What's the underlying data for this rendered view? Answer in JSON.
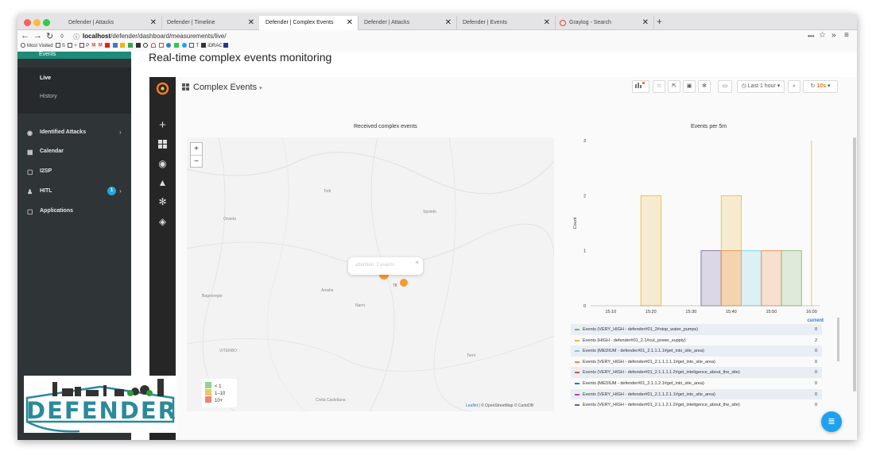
{
  "browser": {
    "tabs": [
      {
        "label": "Defender | Attacks",
        "active": false
      },
      {
        "label": "Defender | Timeline",
        "active": false
      },
      {
        "label": "Defender | Complex Events",
        "active": true
      },
      {
        "label": "Defender | Attacks",
        "active": false
      },
      {
        "label": "Defender | Events",
        "active": false
      },
      {
        "label": "Graylog - Search",
        "active": false
      }
    ],
    "close_glyph": "✕",
    "new_tab": "+",
    "url_prefix": "localhost",
    "url_path": "/defender/dashboard/measurements/live/",
    "bookmarks": [
      "Most Visited",
      "S",
      "+",
      "P",
      "M",
      "M",
      "T",
      "iDRAC"
    ]
  },
  "sidebar": {
    "header": "Events",
    "sub_items": [
      "Live",
      "History"
    ],
    "items": [
      {
        "label": "Identified Attacks",
        "icon": "shield-icon",
        "chevron": "›"
      },
      {
        "label": "Calendar",
        "icon": "calendar-icon",
        "chevron": ""
      },
      {
        "label": "I2SP",
        "icon": "document-icon",
        "chevron": ""
      },
      {
        "label": "HITL",
        "icon": "person-icon",
        "chevron": "›",
        "badge": "1"
      },
      {
        "label": "Applications",
        "icon": "document-icon",
        "chevron": ""
      }
    ]
  },
  "logo": {
    "text": "DEFENDER"
  },
  "page": {
    "title": "Real-time complex events monitoring"
  },
  "grafana": {
    "dashboard_title": "Complex Events",
    "dashboard_caret": "▾",
    "time_range": "Last 1 hour",
    "refresh": "10s",
    "map_panel": {
      "title": "Received complex events",
      "popup_text": "attention: 2 events",
      "cluster_label": "78",
      "places": [
        "Todi",
        "Spoleto",
        "Orvieto",
        "Amelia",
        "Narni",
        "Terni",
        "VITERBO",
        "Civita Castellana",
        "Bagnoregio"
      ],
      "legend": [
        {
          "label": "< 1",
          "color": "#8fd48f"
        },
        {
          "label": "1–10",
          "color": "#f0c75e"
        },
        {
          "label": "10+",
          "color": "#f08080"
        }
      ],
      "attribution_leaflet": "Leaflet",
      "attribution_rest": "| © OpenStreetMap © CartoDB"
    }
  },
  "chart_data": {
    "type": "bar",
    "title": "Events per 5m",
    "ylabel": "Count",
    "xlabel": "",
    "ylim": [
      0,
      3
    ],
    "yticks": [
      0,
      1,
      2,
      3
    ],
    "xticks": [
      "15:10",
      "15:20",
      "15:30",
      "15:40",
      "15:50",
      "16:00"
    ],
    "bars": [
      {
        "time": "15:20",
        "value": 2,
        "series": 1
      },
      {
        "time": "15:35",
        "value": 1,
        "series": 7
      },
      {
        "time": "15:40",
        "value": 2,
        "series": 1
      },
      {
        "time": "15:40",
        "value": 1,
        "series": 3
      },
      {
        "time": "15:45",
        "value": 1,
        "series": 2
      },
      {
        "time": "15:50",
        "value": 1,
        "series": 3
      },
      {
        "time": "15:55",
        "value": 1,
        "series": 0
      }
    ],
    "series": [
      {
        "name": "Events (VERY_HIGH - defender#01_2#stop_water_pumps)",
        "color": "#7eb26d",
        "current": "0"
      },
      {
        "name": "Events (HIGH - defender#01_2.1#cut_power_supply)",
        "color": "#eab839",
        "current": "2"
      },
      {
        "name": "Events (MEDIUM - defender#01_2.1.1.1.1#get_into_site_area)",
        "color": "#6ed0e0",
        "current": "0"
      },
      {
        "name": "Events (VERY_HIGH - defender#01_2.1.1.1.1.1#get_into_site_area)",
        "color": "#ef843c",
        "current": "0"
      },
      {
        "name": "Events (VERY_HIGH - defender#01_2.1.1.1.1.2#get_inteligence_about_the_site)",
        "color": "#e24d42",
        "current": "0"
      },
      {
        "name": "Events (MEDIUM - defender#01_2.1.1.2.1#get_into_site_area)",
        "color": "#1f78c1",
        "current": "0"
      },
      {
        "name": "Events (VERY_HIGH - defender#01_2.1.1.2.1.1#get_into_site_area)",
        "color": "#ba43a9",
        "current": "0"
      },
      {
        "name": "Events (VERY_HIGH - defender#01_2.1.1.2.1.2#get_inteligence_about_the_site)",
        "color": "#705da0",
        "current": "0"
      }
    ],
    "legend_header": "current"
  }
}
